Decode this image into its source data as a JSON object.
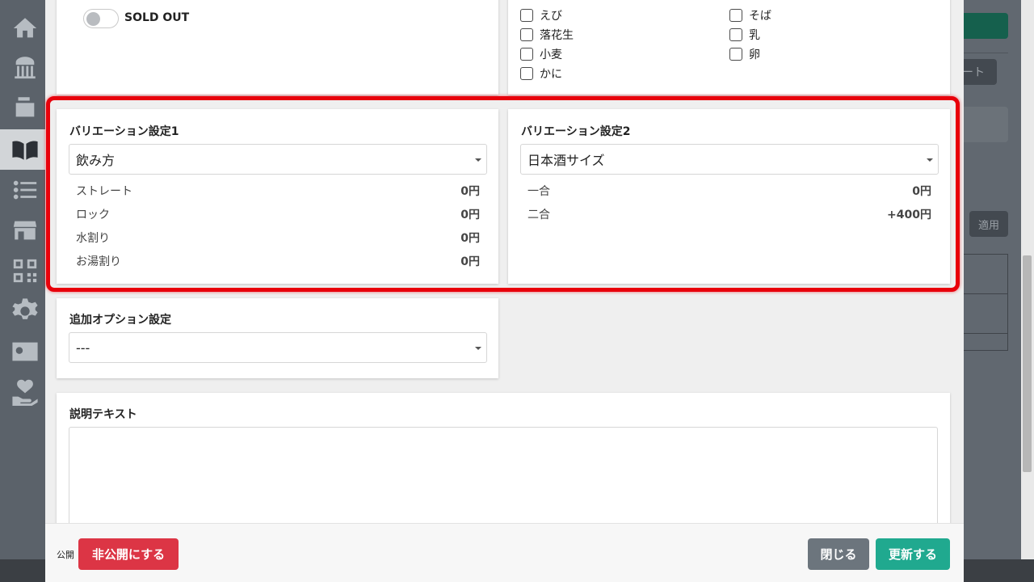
{
  "background": {
    "sidebar_icons": [
      "home-icon",
      "store-icon",
      "register-icon",
      "menu-book-icon",
      "list-icon",
      "shop-icon",
      "qr-code-icon",
      "gear-icon",
      "id-card-icon",
      "hand-heart-icon"
    ],
    "right_button_partial": "ート",
    "apply_button": "適用"
  },
  "soldout": {
    "label": "SOLD OUT",
    "enabled": false
  },
  "allergens": [
    {
      "label": "えび",
      "checked": false
    },
    {
      "label": "そば",
      "checked": false
    },
    {
      "label": "落花生",
      "checked": false
    },
    {
      "label": "乳",
      "checked": false
    },
    {
      "label": "小麦",
      "checked": false
    },
    {
      "label": "卵",
      "checked": false
    },
    {
      "label": "かに",
      "checked": false
    }
  ],
  "variation1": {
    "title": "バリエーション設定1",
    "selected": "飲み方",
    "rows": [
      {
        "name": "ストレート",
        "price": "0円"
      },
      {
        "name": "ロック",
        "price": "0円"
      },
      {
        "name": "水割り",
        "price": "0円"
      },
      {
        "name": "お湯割り",
        "price": "0円"
      }
    ]
  },
  "variation2": {
    "title": "バリエーション設定2",
    "selected": "日本酒サイズ",
    "rows": [
      {
        "name": "一合",
        "price": "0円"
      },
      {
        "name": "二合",
        "price": "+400円"
      }
    ]
  },
  "options": {
    "title": "追加オプション設定",
    "selected": "---"
  },
  "description": {
    "title": "説明テキスト",
    "value": ""
  },
  "footer": {
    "public_label": "公開",
    "unpublish_button": "非公開にする",
    "close_button": "閉じる",
    "update_button": "更新する"
  },
  "colors": {
    "highlight": "#e8000b",
    "danger": "#dc3545",
    "secondary": "#6c757d",
    "primary": "#20a98f"
  }
}
